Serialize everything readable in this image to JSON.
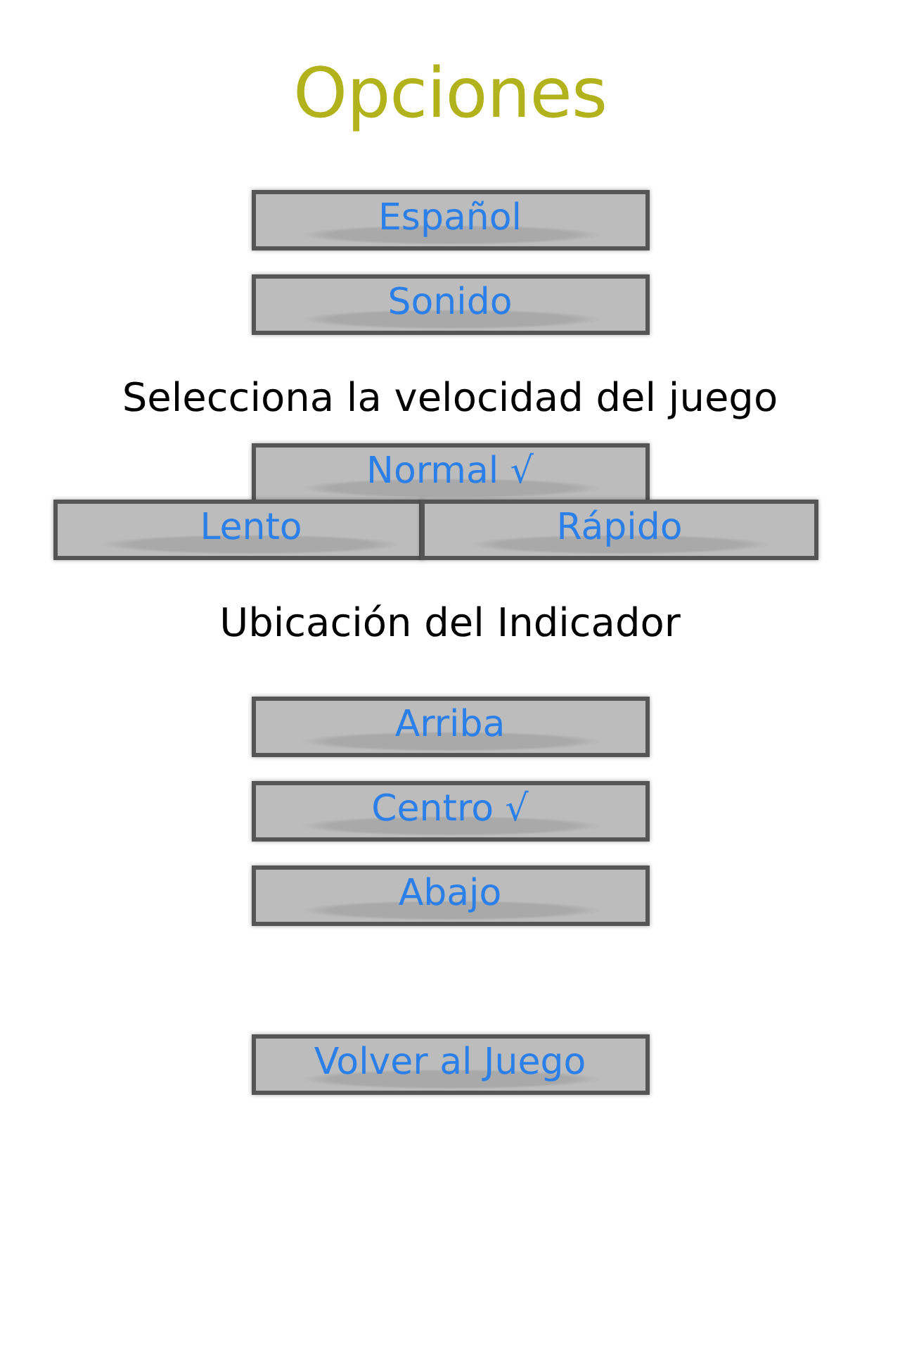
{
  "title": "Opciones",
  "menu_buttons": [
    {
      "label": "Español"
    },
    {
      "label": "Sonido"
    }
  ],
  "speed": {
    "heading": "Selecciona la velocidad del juego",
    "options": [
      {
        "label": "Normal √"
      },
      {
        "label": "Lento"
      },
      {
        "label": "Rápido"
      }
    ]
  },
  "indicator": {
    "heading": "Ubicación del Indicador",
    "options": [
      {
        "label": "Arriba"
      },
      {
        "label": "Centro √"
      },
      {
        "label": "Abajo"
      }
    ]
  },
  "back_button": {
    "label": "Volver al Juego"
  }
}
